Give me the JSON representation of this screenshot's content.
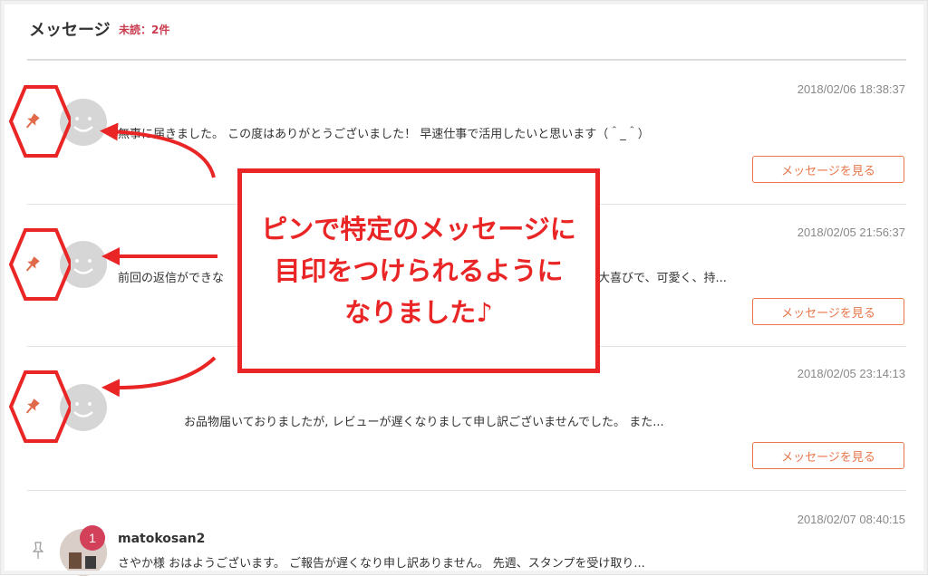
{
  "header": {
    "title": "メッセージ",
    "unread": "未読：2件"
  },
  "messages": [
    {
      "date": "2018/02/06 18:38:37",
      "sender": "",
      "preview": "無事に届きました。 この度はありがとうございました！ 早速仕事で活用したいと思います（＾_＾）",
      "button": "メッセージを見る",
      "pinned": true
    },
    {
      "date": "2018/02/05 21:56:37",
      "sender": "",
      "preview_left": "前回の返信ができな",
      "preview_right": "大喜びで、可愛く、持...",
      "button": "メッセージを見る",
      "pinned": true
    },
    {
      "date": "2018/02/05 23:14:13",
      "sender": "",
      "preview": "お品物届いておりましたが, レビューが遅くなりまして申し訳ございませんでした。 また...",
      "button": "メッセージを見る",
      "pinned": true
    },
    {
      "date": "2018/02/07 08:40:15",
      "sender": "matokosan2",
      "badge": "1",
      "preview": "さやか様 おはようございます。 ご報告が遅くなり申し訳ありません。 先週、スタンプを受け取り...",
      "pinned": false
    }
  ],
  "callout": {
    "line1": "ピンで特定のメッセージに",
    "line2": "目印をつけられるように",
    "line3": "なりました♪"
  },
  "colors": {
    "accent": "#e8764a",
    "annotation_red": "#ea2525",
    "unread_red": "#c93b4f",
    "badge": "#d2405a"
  },
  "icons": {
    "pin": "pin-icon",
    "avatar": "smiley-avatar-icon"
  }
}
